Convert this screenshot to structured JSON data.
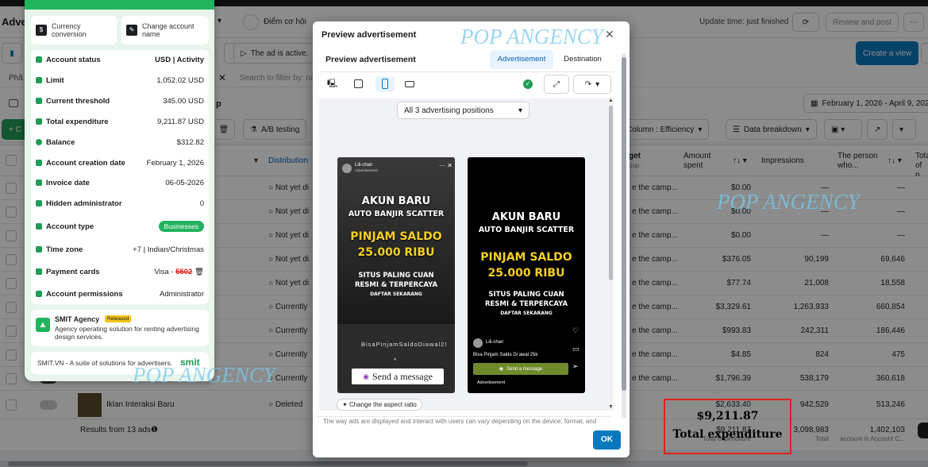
{
  "app": {
    "title": "Adve",
    "objective_label": "Điểm cơ hội",
    "update_time": "Update time: just finished",
    "review_button": "Review and post",
    "create_view_button": "Create a view",
    "ad_active_toggle": "The ad is active.",
    "filter_placeholder": "Search to filter by: nam",
    "filter_prefix": "Phâ",
    "date_range": "February 1, 2026 - April 9, 2026",
    "ab_testing": "A/B testing",
    "column_button": "Column : Efficiency",
    "breakdown_button": "Data breakdown",
    "add_button": "+ C"
  },
  "table": {
    "headers": {
      "distribution": "Distribution",
      "budget": "get",
      "budget_sub": "oup",
      "amount_spent": "Amount spent",
      "impressions": "Impressions",
      "person_who": "The person who...",
      "total": "Tota",
      "total_sub": "of p"
    },
    "rows": [
      {
        "distribution": "Not yet di",
        "budget": "e the camp...",
        "spent": "$0.00",
        "impressions": "—",
        "persons": "—"
      },
      {
        "distribution": "Not yet di",
        "budget": "e the camp...",
        "spent": "$0.00",
        "impressions": "—",
        "persons": "—"
      },
      {
        "distribution": "Not yet di",
        "budget": "e the camp...",
        "spent": "$0.00",
        "impressions": "—",
        "persons": "—"
      },
      {
        "distribution": "Not yet di",
        "budget": "e the camp...",
        "spent": "$376.05",
        "impressions": "90,199",
        "persons": "69,646"
      },
      {
        "distribution": "Not yet di",
        "budget": "e the camp...",
        "spent": "$77.74",
        "impressions": "21,008",
        "persons": "18,558"
      },
      {
        "distribution": "Currently",
        "budget": "e the camp...",
        "spent": "$3,329.61",
        "impressions": "1,263,933",
        "persons": "660,854"
      },
      {
        "distribution": "Currently",
        "budget": "e the camp...",
        "spent": "$993.83",
        "impressions": "242,311",
        "persons": "186,446"
      },
      {
        "distribution": "Currently",
        "budget": "e the camp...",
        "spent": "$4.85",
        "impressions": "824",
        "persons": "475"
      },
      {
        "distribution": "Currently",
        "budget": "e the camp...",
        "spent": "$1,796.39",
        "impressions": "538,179",
        "persons": "360,618"
      },
      {
        "name": "Iklan Interaksi Baru",
        "distribution": "Deleted",
        "budget": "",
        "spent": "$2,633.40",
        "impressions": "942,529",
        "persons": "513,246"
      }
    ],
    "footer": {
      "results": "Results from 13 ads",
      "spent": "$9,211.87",
      "spent_sub": "Total expenditure",
      "impressions": "3,098,983",
      "impressions_sub": "Total",
      "persons": "1,402,103",
      "persons_sub": "account in Account C..."
    }
  },
  "panel": {
    "currency_conversion": "Currency conversion",
    "change_account_name": "Change account name",
    "rows": [
      {
        "label": "Account status",
        "value": "USD | Activity"
      },
      {
        "label": "Limit",
        "value": "1,052.02 USD"
      },
      {
        "label": "Current threshold",
        "value": "345.00 USD"
      },
      {
        "label": "Total expenditure",
        "value": "9,211.87 USD"
      },
      {
        "label": "Balance",
        "value": "$312.82"
      },
      {
        "label": "Account creation date",
        "value": "February 1, 2026"
      },
      {
        "label": "Invoice date",
        "value": "06-05-2026"
      },
      {
        "label": "Hidden administrator",
        "value": "0"
      },
      {
        "label": "Account type",
        "value": "Businesses"
      },
      {
        "label": "Time zone",
        "value": "+7 | Indian/Christmas"
      },
      {
        "label": "Payment cards",
        "value": "Visa - ",
        "masked": "5502"
      },
      {
        "label": "Account permissions",
        "value": "Administrator"
      }
    ],
    "smit": {
      "title": "SMIT Agency",
      "badge": "Released",
      "desc": "Agency operating solution for renting advertising design services.",
      "footer": "SMIT.VN - A suite of solutions for advertisers.",
      "logo": "smit"
    }
  },
  "modal": {
    "title": "Preview advertisement",
    "subtitle": "Preview advertisement",
    "tab_advertisement": "Advertisement",
    "tab_destination": "Destination",
    "positions_select": "All 3 advertising positions",
    "aspect_ratio": "Change the aspect ratio",
    "disclaimer": "The way ads are displayed and interact with users can vary depending on the device, format, and",
    "ok": "OK",
    "story": {
      "username": "Lili-chan",
      "sub": "Advertisement",
      "bottom_text": "BisaPinjamSaldoDiawal2!",
      "send": "Send a message"
    },
    "reel": {
      "username": "Lili-chan",
      "caption": "Bisa Pinjam Saldo Di awal 25k",
      "send": "Send a message",
      "sponsored": "Advertisement"
    },
    "creative": {
      "line1": "AKUN BARU",
      "line2": "AUTO BANJIR SCATTER",
      "line3": "PINJAM SALDO",
      "line4": "25.000 RIBU",
      "line5": "SITUS PALING CUAN",
      "line6": "RESMI & TERPERCAYA",
      "line7": "DAFTAR SEKARANG"
    }
  },
  "watermarks": [
    "POP ANGENCY",
    "POP ANGENCY",
    "POP ANGENCY"
  ],
  "highlight": {
    "amount": "$9,211.87",
    "label": "Total expenditure"
  },
  "colors": {
    "accent": "#0a78be",
    "green": "#1f9d55",
    "highlight_border": "#e0201b"
  }
}
